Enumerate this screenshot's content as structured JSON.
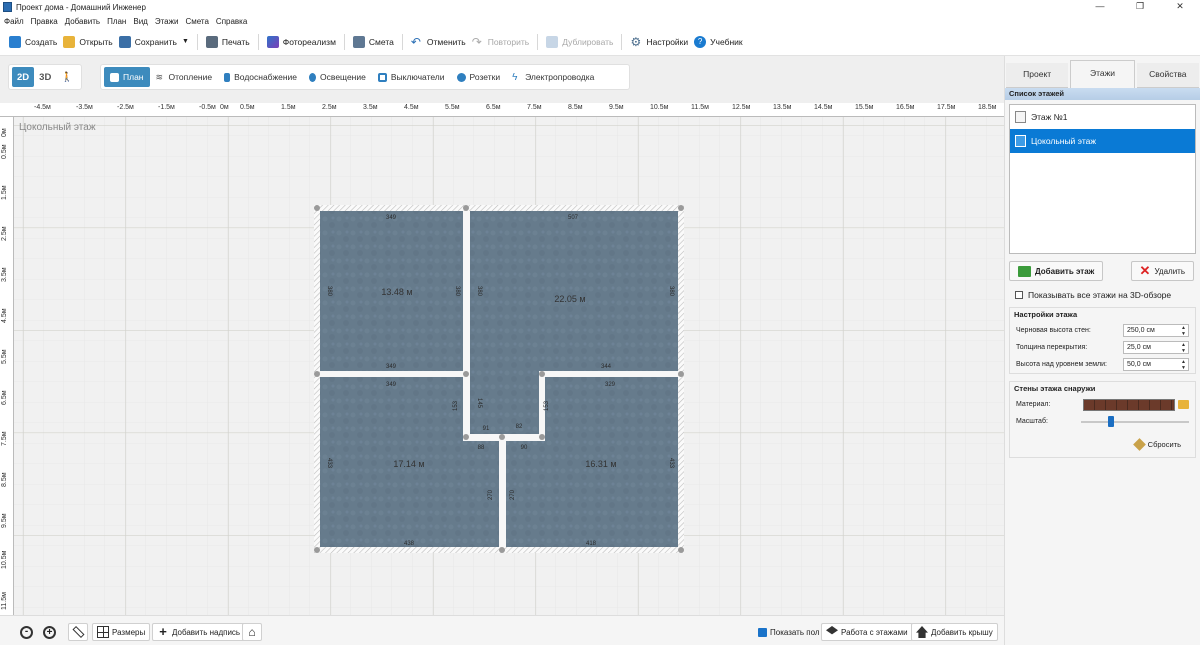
{
  "window": {
    "title": "Проект дома - Домашний Инженер",
    "controls": [
      "—",
      "❐",
      "✕"
    ]
  },
  "menu": [
    "Файл",
    "Правка",
    "Добавить",
    "План",
    "Вид",
    "Этажи",
    "Смета",
    "Справка"
  ],
  "toolbar": {
    "create": "Создать",
    "open": "Открыть",
    "save": "Сохранить",
    "save_arrow": "▼",
    "print": "Печать",
    "photorealism": "Фотореализм",
    "estimate": "Смета",
    "undo": "Отменить",
    "redo": "Повторить",
    "duplicate": "Дублировать",
    "settings": "Настройки",
    "tutorial": "Учебник"
  },
  "view_modes": {
    "mode_2d": "2D",
    "mode_3d": "3D",
    "walk": "🚶"
  },
  "layers": [
    "План",
    "Отопление",
    "Водоснабжение",
    "Освещение",
    "Выключатели",
    "Розетки",
    "Электропроводка"
  ],
  "ruler": {
    "h_labels": [
      "-4.5м",
      "-3.5м",
      "-2.5м",
      "-1.5м",
      "-0.5м",
      "0м",
      "0.5м",
      "1.5м",
      "2.5м",
      "3.5м",
      "4.5м",
      "5.5м",
      "6.5м",
      "7.5м",
      "8.5м",
      "9.5м",
      "10.5м",
      "11.5м",
      "12.5м",
      "13.5м",
      "14.5м",
      "15.5м",
      "16.5м",
      "17.5м",
      "18.5м"
    ],
    "v_labels": [
      "0м",
      "0.5м",
      "1.5м",
      "2.5м",
      "3.5м",
      "4.5м",
      "5.5м",
      "6.5м",
      "7.5м",
      "8.5м",
      "9.5м",
      "10.5м",
      "11.5м"
    ]
  },
  "floor_label": "Цокольный этаж",
  "plan": {
    "rooms": [
      {
        "area": "13.48 м",
        "dims": {
          "top": "349",
          "bottom": "349",
          "left": "380",
          "right": "380"
        }
      },
      {
        "area": "22.05 м",
        "dims": {
          "top": "507",
          "bottom": "344",
          "left": "380",
          "right": "380"
        }
      },
      {
        "area": "17.14 м",
        "dims": {
          "top": "349",
          "bottom": "438",
          "left": "433",
          "right": "270"
        }
      },
      {
        "area": "16.31 м",
        "dims": {
          "top": "329",
          "bottom": "418",
          "left": "270",
          "right": "433"
        }
      }
    ],
    "inner": {
      "a": "153",
      "b": "145",
      "c": "153",
      "d": "91",
      "e": "82",
      "f": "88",
      "g": "90"
    }
  },
  "bottombar": {
    "sizes": "Размеры",
    "add_label": "Добавить надпись",
    "show_floor": "Показать пол",
    "floors_work": "Работа с этажами",
    "add_roof": "Добавить крышу"
  },
  "right_panel": {
    "tabs": [
      "Проект",
      "Этажи",
      "Свойства"
    ],
    "floor_list_title": "Список этажей",
    "floors": [
      "Этаж №1",
      "Цокольный этаж"
    ],
    "add_floor": "Добавить этаж",
    "delete": "Удалить",
    "show_all_3d": "Показывать все этажи на 3D-обзоре",
    "floor_settings": {
      "title": "Настройки этажа",
      "rows": [
        {
          "label": "Черновая высота стен:",
          "value": "250,0 см"
        },
        {
          "label": "Толщина перекрытия:",
          "value": "25,0 см"
        },
        {
          "label": "Высота над уровнем земли:",
          "value": "50,0 см"
        }
      ]
    },
    "walls_outside": {
      "title": "Стены этажа снаружи",
      "material": "Материал:",
      "scale": "Масштаб:",
      "reset": "Сбросить",
      "scale_level": 0.25
    }
  },
  "colors": {
    "accent": "#3d8bbd",
    "selection": "#0a7ad5",
    "floor_fill": "#6a7f8f"
  }
}
